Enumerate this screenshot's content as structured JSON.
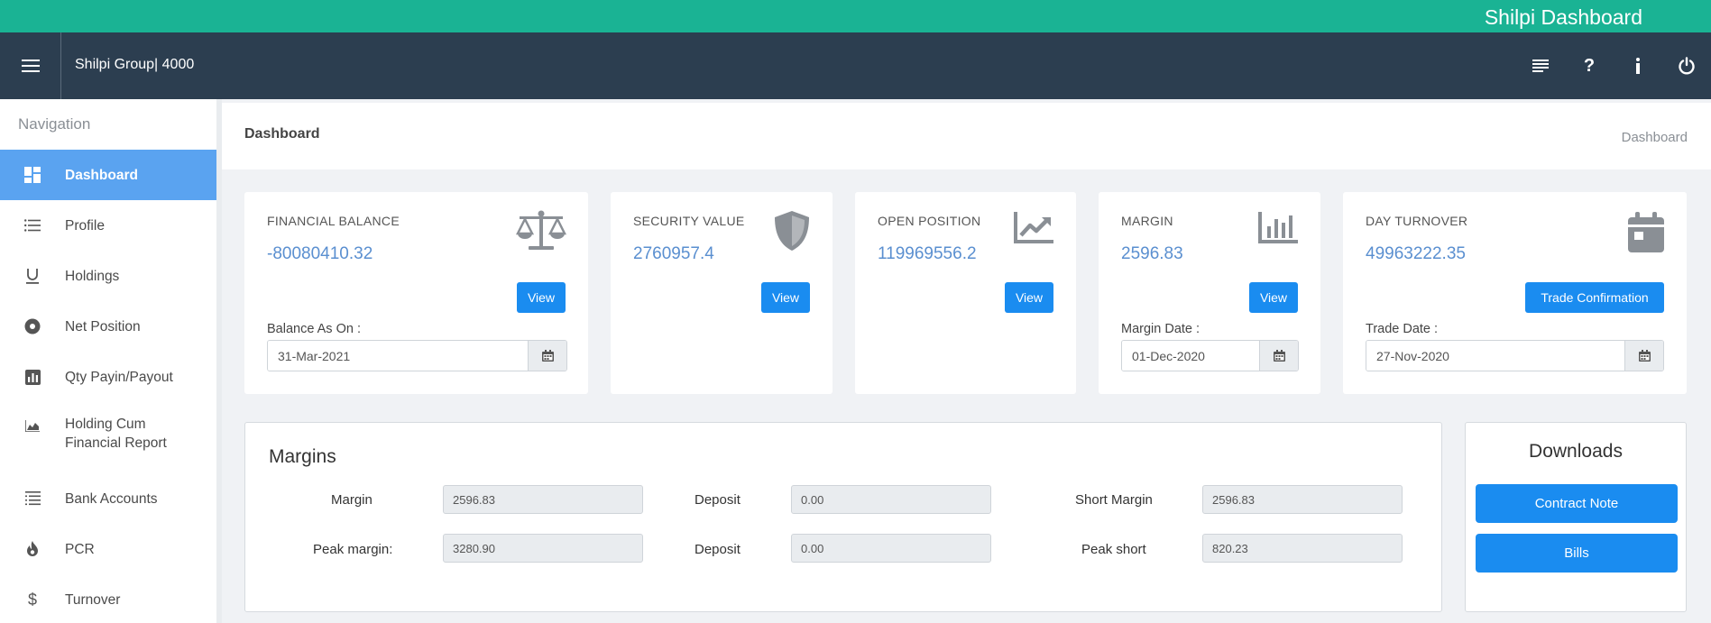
{
  "brand": "Shilpi Dashboard",
  "company": "Shilpi Group| 4000",
  "nav_icons": [
    "list-icon",
    "help-icon",
    "info-icon",
    "power-icon"
  ],
  "sidebar": {
    "title": "Navigation",
    "items": [
      {
        "label": "Dashboard",
        "icon": "dashboard-icon",
        "active": true
      },
      {
        "label": "Profile",
        "icon": "list-icon"
      },
      {
        "label": "Holdings",
        "icon": "underline-icon"
      },
      {
        "label": "Net Position",
        "icon": "disc-icon"
      },
      {
        "label": "Qty Payin/Payout",
        "icon": "bar-chart-icon"
      },
      {
        "label": "Holding Cum Financial Report",
        "icon": "area-chart-icon"
      },
      {
        "label": "Bank Accounts",
        "icon": "ledger-icon"
      },
      {
        "label": "PCR",
        "icon": "fire-icon"
      },
      {
        "label": "Turnover",
        "icon": "dollar-icon"
      }
    ]
  },
  "header": {
    "title": "Dashboard",
    "breadcrumb": "Dashboard"
  },
  "cards": [
    {
      "title": "FINANCIAL BALANCE",
      "value": "-80080410.32",
      "button": "View",
      "date_label": "Balance As On :",
      "date": "31-Mar-2021",
      "icon": "balance-scale-icon"
    },
    {
      "title": "SECURITY VALUE",
      "value": "2760957.4",
      "button": "View",
      "icon": "shield-icon"
    },
    {
      "title": "OPEN POSITION",
      "value": "119969556.2",
      "button": "View",
      "icon": "trend-up-icon"
    },
    {
      "title": "MARGIN",
      "value": "2596.83",
      "button": "View",
      "date_label": "Margin Date :",
      "date": "01-Dec-2020",
      "icon": "column-chart-icon"
    },
    {
      "title": "DAY TURNOVER",
      "value": "49963222.35",
      "button": "Trade Confirmation",
      "date_label": "Trade Date :",
      "date": "27-Nov-2020",
      "icon": "calendar-icon"
    }
  ],
  "margins": {
    "title": "Margins",
    "row1": {
      "margin_label": "Margin",
      "margin": "2596.83",
      "deposit_label": "Deposit",
      "deposit": "0.00",
      "short_label": "Short Margin",
      "short": "2596.83"
    },
    "row2": {
      "margin_label": "Peak margin:",
      "margin": "3280.90",
      "deposit_label": "Deposit",
      "deposit": "0.00",
      "short_label": "Peak short",
      "short": "820.23"
    }
  },
  "downloads": {
    "title": "Downloads",
    "contract_note": "Contract Note",
    "bills": "Bills"
  },
  "colors": {
    "topbar": "#1ab394",
    "navbar": "#2c3e50",
    "active": "#5aa3f0",
    "button": "#1a8cf0",
    "value": "#5a8fd0"
  }
}
